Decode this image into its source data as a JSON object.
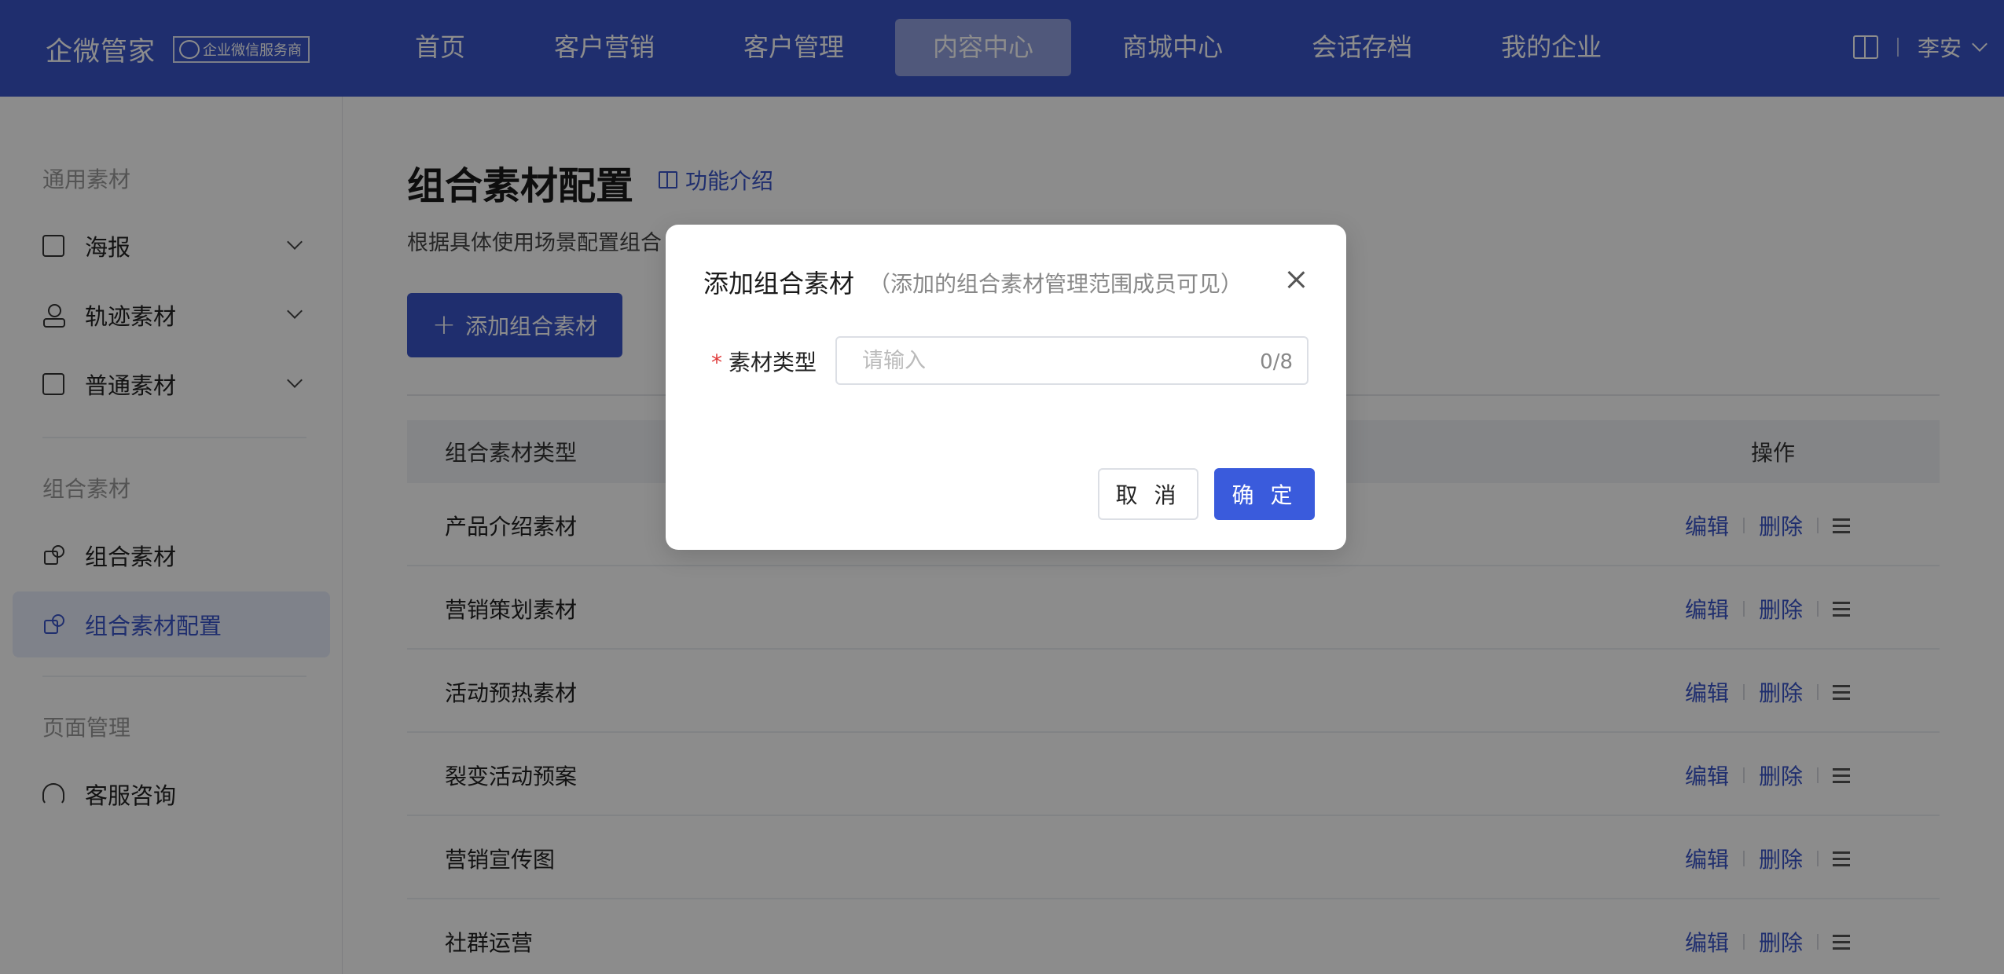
{
  "brand": {
    "name": "企微管家",
    "badge": "企业微信服务商"
  },
  "nav": {
    "items": [
      "首页",
      "客户营销",
      "客户管理",
      "内容中心",
      "商城中心",
      "会话存档",
      "我的企业"
    ],
    "active": "内容中心"
  },
  "user": {
    "name": "李安"
  },
  "sidebar": {
    "group1": "通用素材",
    "items1": [
      "海报",
      "轨迹素材",
      "普通素材"
    ],
    "group2": "组合素材",
    "items2": [
      "组合素材",
      "组合素材配置"
    ],
    "group3": "页面管理",
    "items3": [
      "客服咨询"
    ]
  },
  "main": {
    "title": "组合素材配置",
    "intro_link": "功能介绍",
    "description": "根据具体使用场景配置组合",
    "add_button": "添加组合素材",
    "table": {
      "col_type": "组合素材类型",
      "col_op": "操作",
      "rows": [
        "产品介绍素材",
        "营销策划素材",
        "活动预热素材",
        "裂变活动预案",
        "营销宣传图",
        "社群运营"
      ],
      "edit": "编辑",
      "delete": "删除"
    }
  },
  "dialog": {
    "title": "添加组合素材",
    "subtitle": "（添加的组合素材管理范围成员可见）",
    "field_label": "素材类型",
    "required_mark": "*",
    "placeholder": "请输入",
    "value": "",
    "counter": "0/8",
    "cancel": "取 消",
    "confirm": "确 定"
  },
  "colors": {
    "primary": "#3a55c8",
    "confirm": "#3a5bdc",
    "required": "#e03a3a"
  }
}
